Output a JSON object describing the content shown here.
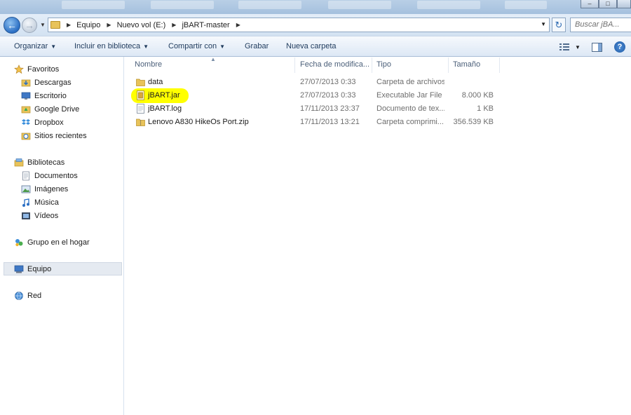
{
  "address": {
    "crumbs": [
      "Equipo",
      "Nuevo vol (E:)",
      "jBART-master"
    ],
    "search_placeholder": "Buscar jBA..."
  },
  "toolbar": {
    "organize": "Organizar",
    "include": "Incluir en biblioteca",
    "share": "Compartir con",
    "burn": "Grabar",
    "new_folder": "Nueva carpeta"
  },
  "nav": {
    "favorites": "Favoritos",
    "fav_items": [
      "Descargas",
      "Escritorio",
      "Google Drive",
      "Dropbox",
      "Sitios recientes"
    ],
    "libraries": "Bibliotecas",
    "lib_items": [
      "Documentos",
      "Imágenes",
      "Música",
      "Vídeos"
    ],
    "homegroup": "Grupo en el hogar",
    "computer": "Equipo",
    "network": "Red"
  },
  "columns": {
    "name": "Nombre",
    "date": "Fecha de modifica...",
    "type": "Tipo",
    "size": "Tamaño"
  },
  "files": [
    {
      "name": "data",
      "date": "27/07/2013 0:33",
      "type": "Carpeta de archivos",
      "size": "",
      "icon": "folder-icon"
    },
    {
      "name": "jBART.jar",
      "date": "27/07/2013 0:33",
      "type": "Executable Jar File",
      "size": "8.000 KB",
      "icon": "jar-file-icon"
    },
    {
      "name": "jBART.log",
      "date": "17/11/2013 23:37",
      "type": "Documento de tex...",
      "size": "1 KB",
      "icon": "text-file-icon"
    },
    {
      "name": "Lenovo A830 HikeOs Port.zip",
      "date": "17/11/2013 13:21",
      "type": "Carpeta comprimi...",
      "size": "356.539 KB",
      "icon": "zip-folder-icon"
    }
  ],
  "colors": {
    "highlight": "#ffff00",
    "accent": "#2b6fc4"
  }
}
